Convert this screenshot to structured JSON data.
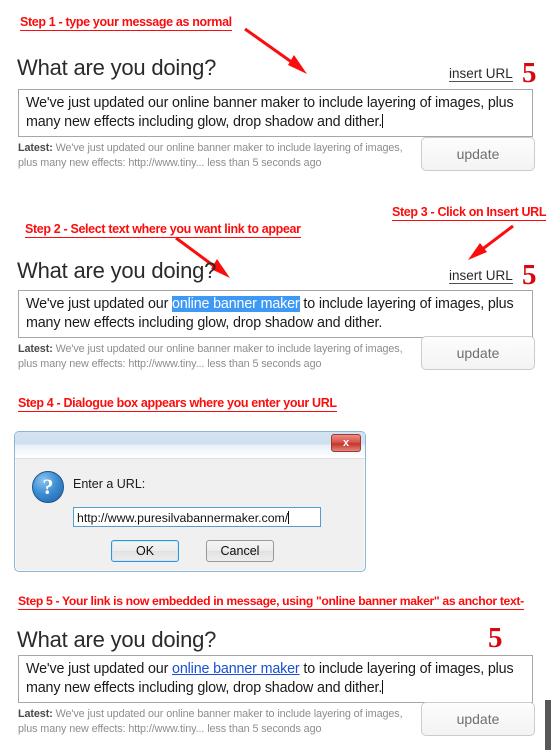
{
  "annotations": {
    "step1": "Step 1 - type your message as normal",
    "step2": "Step 2 - Select text where you want link to appear",
    "step3": "Step 3 - Click on Insert URL",
    "step4": "Step 4 - Dialogue box appears where you enter your URL",
    "step5": "Step 5 - Your link is now embedded in message, using \"online banner maker\" as anchor text-",
    "marker": "5",
    "arrow_color": "#fb0d0d",
    "caption_color": "#fb0d0d",
    "marker_color": "#d9070f"
  },
  "widget": {
    "heading": "What are you doing?",
    "insert_url_label": "insert URL",
    "update_label": "update",
    "latest_prefix": "Latest:",
    "latest_text": "We've just updated our online banner maker to include layering of images, plus many new effects: http://www.tiny... less than 5 seconds ago",
    "message": {
      "before_selection": "We've just updated our ",
      "selection": "online banner maker",
      "after_selection": " to include layering of images, plus many new effects including glow, drop shadow and dither.",
      "plain_full": "We've just updated our online banner maker to include layering of images, plus many new effects including glow, drop shadow and dither."
    },
    "selection_color": "#3d99f5",
    "link_color": "#1a4fd6"
  },
  "dialog": {
    "title": "",
    "close_label": "x",
    "icon": "?",
    "prompt": "Enter a URL:",
    "url_value": "http://www.puresilvabannermaker.com/",
    "ok_label": "OK",
    "cancel_label": "Cancel"
  }
}
